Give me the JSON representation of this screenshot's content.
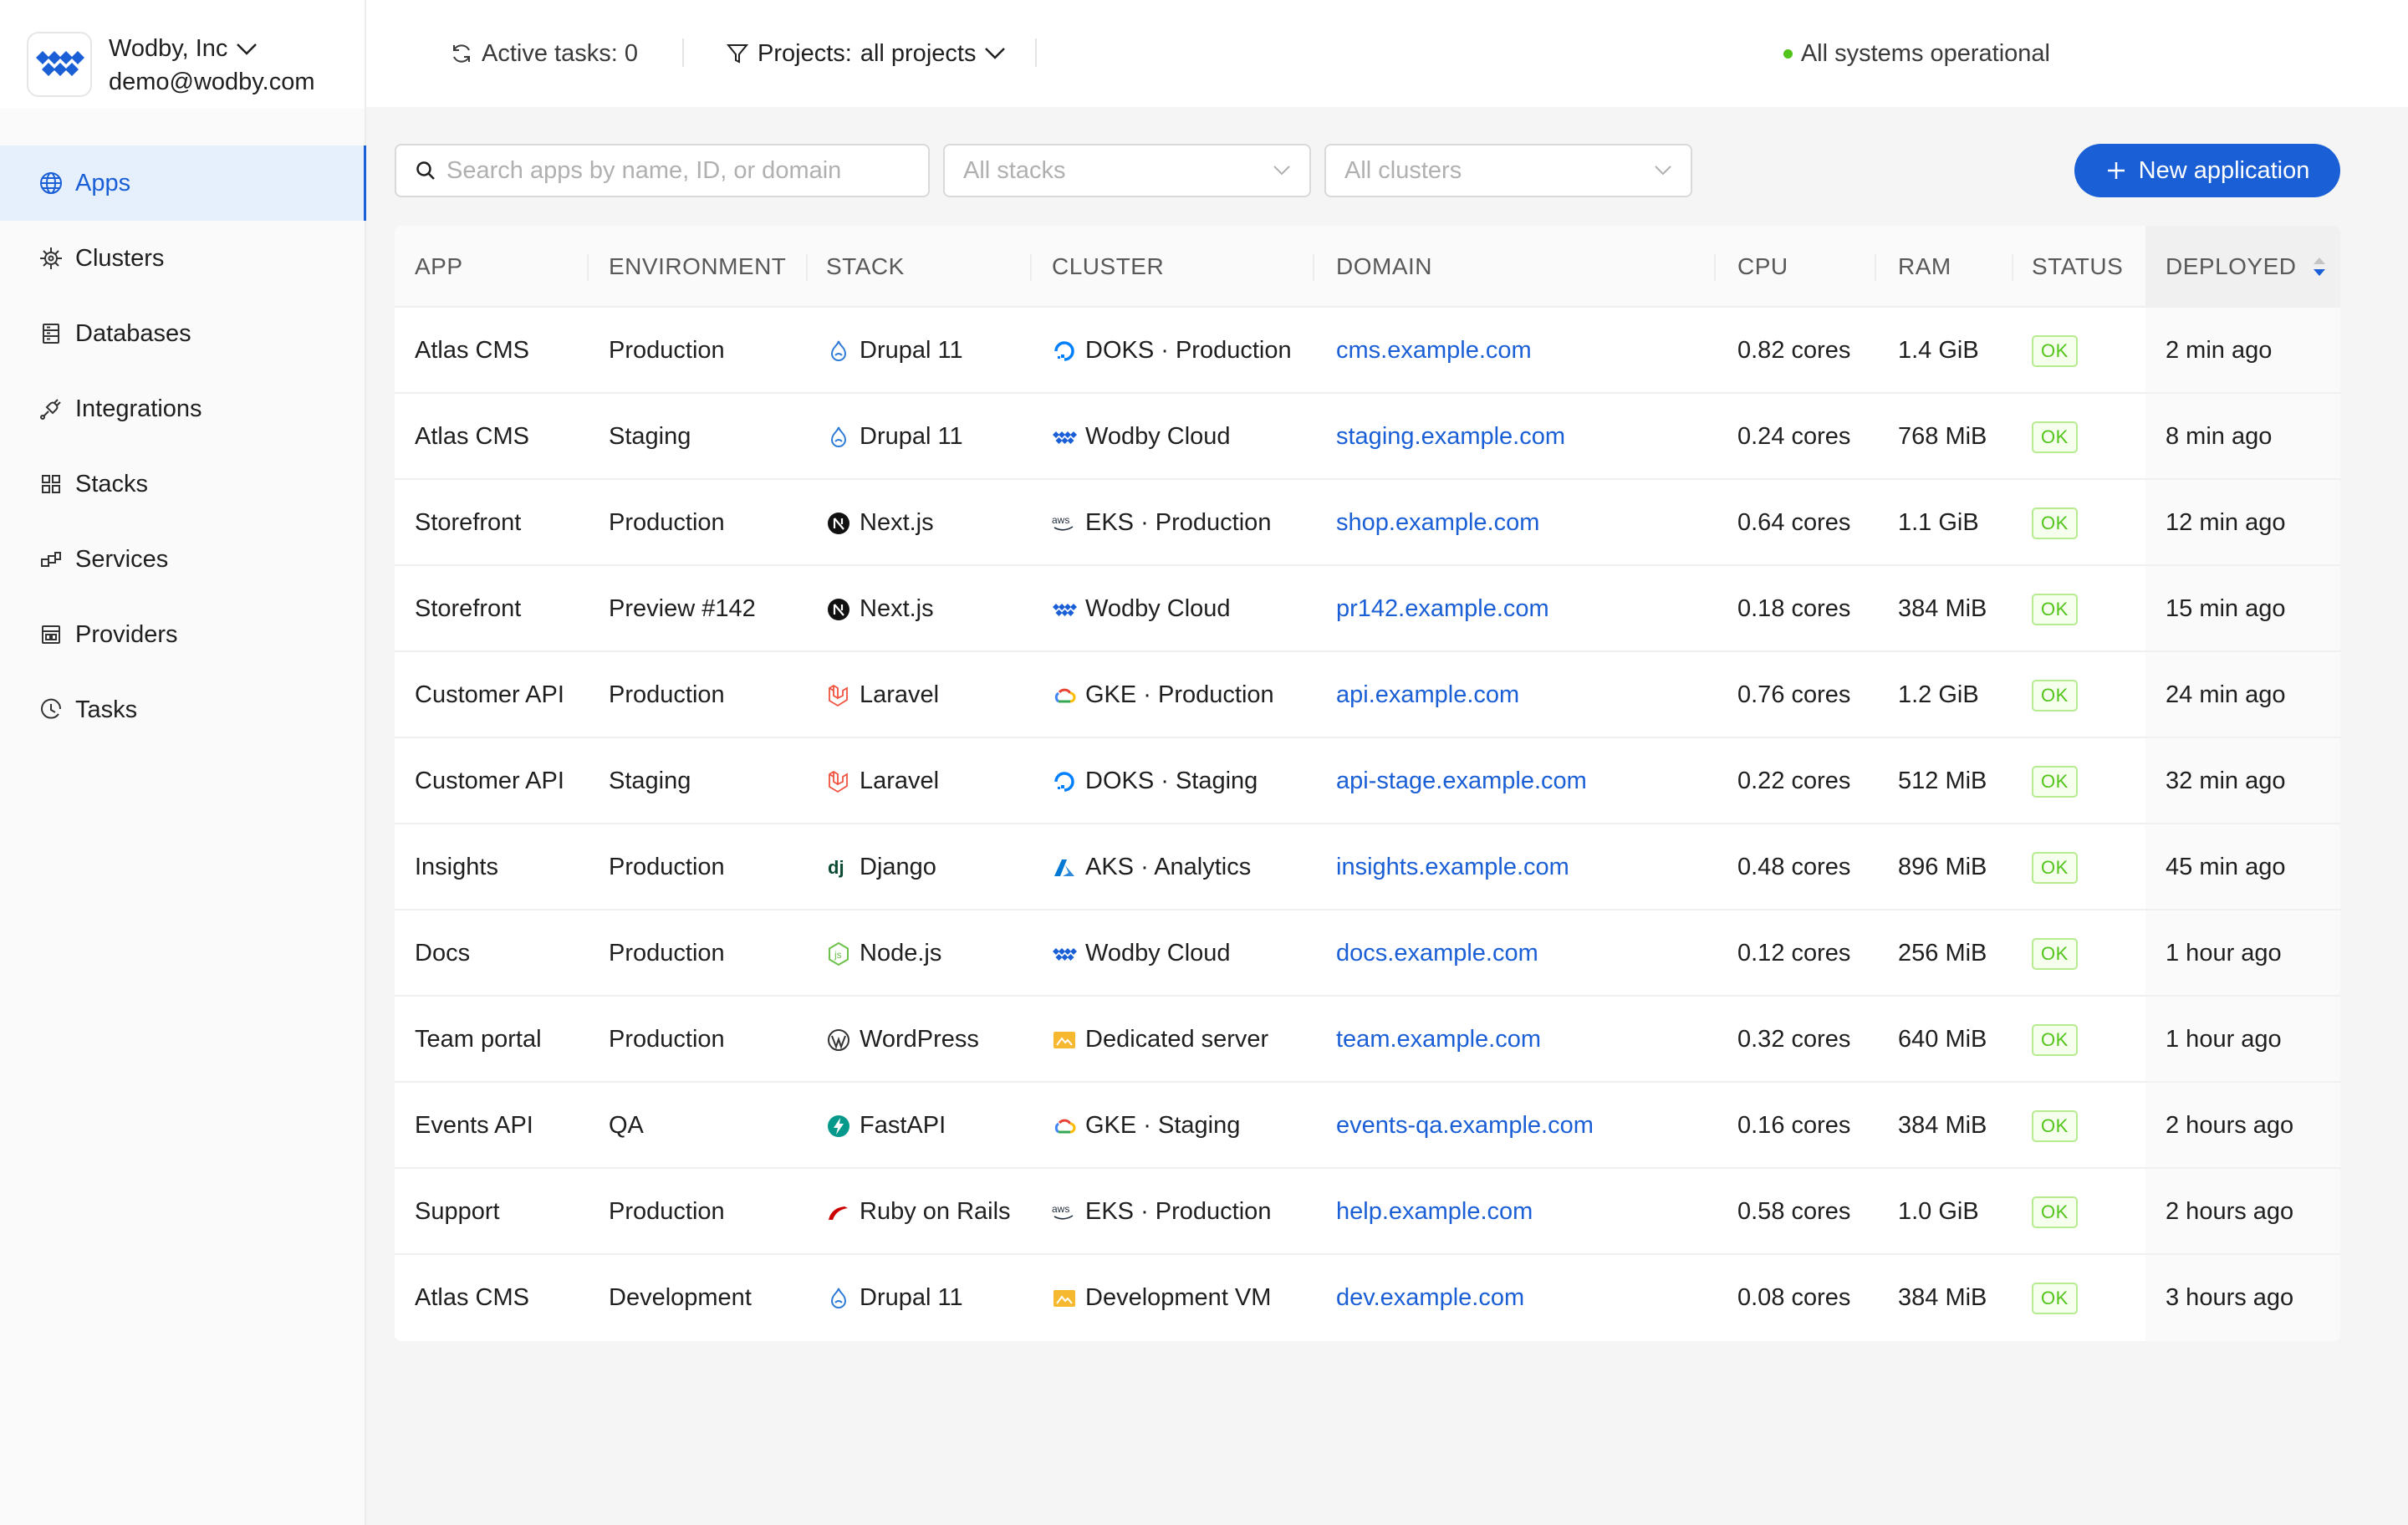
{
  "org": {
    "name": "Wodby, Inc",
    "email": "demo@wodby.com"
  },
  "nav": [
    {
      "label": "Apps",
      "icon": "globe-icon",
      "active": true
    },
    {
      "label": "Clusters",
      "icon": "helm-icon",
      "active": false
    },
    {
      "label": "Databases",
      "icon": "database-icon",
      "active": false
    },
    {
      "label": "Integrations",
      "icon": "plug-icon",
      "active": false
    },
    {
      "label": "Stacks",
      "icon": "grid-icon",
      "active": false
    },
    {
      "label": "Services",
      "icon": "blocks-icon",
      "active": false
    },
    {
      "label": "Providers",
      "icon": "server-icon",
      "active": false
    },
    {
      "label": "Tasks",
      "icon": "history-icon",
      "active": false
    }
  ],
  "topbar": {
    "active_tasks": "Active tasks: 0",
    "projects_label": "Projects:",
    "projects_value": "all projects",
    "system_status": "All systems operational"
  },
  "toolbar": {
    "search_placeholder": "Search apps by name, ID, or domain",
    "stacks_placeholder": "All stacks",
    "clusters_placeholder": "All clusters",
    "new_app_label": "New application"
  },
  "table": {
    "headers": {
      "app": "APP",
      "environment": "ENVIRONMENT",
      "stack": "STACK",
      "cluster": "CLUSTER",
      "domain": "DOMAIN",
      "cpu": "CPU",
      "ram": "RAM",
      "status": "STATUS",
      "deployed": "DEPLOYED"
    },
    "rows": [
      {
        "app": "Atlas CMS",
        "environment": "Production",
        "stack": "Drupal 11",
        "stack_icon": "drupal-icon",
        "cluster": "DOKS · Production",
        "cluster_icon": "digitalocean-icon",
        "domain": "cms.example.com",
        "cpu": "0.82 cores",
        "ram": "1.4 GiB",
        "status": "OK",
        "deployed": "2 min ago"
      },
      {
        "app": "Atlas CMS",
        "environment": "Staging",
        "stack": "Drupal 11",
        "stack_icon": "drupal-icon",
        "cluster": "Wodby Cloud",
        "cluster_icon": "wodby-icon",
        "domain": "staging.example.com",
        "cpu": "0.24 cores",
        "ram": "768 MiB",
        "status": "OK",
        "deployed": "8 min ago"
      },
      {
        "app": "Storefront",
        "environment": "Production",
        "stack": "Next.js",
        "stack_icon": "nextjs-icon",
        "cluster": "EKS · Production",
        "cluster_icon": "aws-icon",
        "domain": "shop.example.com",
        "cpu": "0.64 cores",
        "ram": "1.1 GiB",
        "status": "OK",
        "deployed": "12 min ago"
      },
      {
        "app": "Storefront",
        "environment": "Preview #142",
        "stack": "Next.js",
        "stack_icon": "nextjs-icon",
        "cluster": "Wodby Cloud",
        "cluster_icon": "wodby-icon",
        "domain": "pr142.example.com",
        "cpu": "0.18 cores",
        "ram": "384 MiB",
        "status": "OK",
        "deployed": "15 min ago"
      },
      {
        "app": "Customer API",
        "environment": "Production",
        "stack": "Laravel",
        "stack_icon": "laravel-icon",
        "cluster": "GKE · Production",
        "cluster_icon": "gcloud-icon",
        "domain": "api.example.com",
        "cpu": "0.76 cores",
        "ram": "1.2 GiB",
        "status": "OK",
        "deployed": "24 min ago"
      },
      {
        "app": "Customer API",
        "environment": "Staging",
        "stack": "Laravel",
        "stack_icon": "laravel-icon",
        "cluster": "DOKS · Staging",
        "cluster_icon": "digitalocean-icon",
        "domain": "api-stage.example.com",
        "cpu": "0.22 cores",
        "ram": "512 MiB",
        "status": "OK",
        "deployed": "32 min ago"
      },
      {
        "app": "Insights",
        "environment": "Production",
        "stack": "Django",
        "stack_icon": "django-icon",
        "cluster": "AKS · Analytics",
        "cluster_icon": "azure-icon",
        "domain": "insights.example.com",
        "cpu": "0.48 cores",
        "ram": "896 MiB",
        "status": "OK",
        "deployed": "45 min ago"
      },
      {
        "app": "Docs",
        "environment": "Production",
        "stack": "Node.js",
        "stack_icon": "nodejs-icon",
        "cluster": "Wodby Cloud",
        "cluster_icon": "wodby-icon",
        "domain": "docs.example.com",
        "cpu": "0.12 cores",
        "ram": "256 MiB",
        "status": "OK",
        "deployed": "1 hour ago"
      },
      {
        "app": "Team portal",
        "environment": "Production",
        "stack": "WordPress",
        "stack_icon": "wordpress-icon",
        "cluster": "Dedicated server",
        "cluster_icon": "server-box-icon",
        "domain": "team.example.com",
        "cpu": "0.32 cores",
        "ram": "640 MiB",
        "status": "OK",
        "deployed": "1 hour ago"
      },
      {
        "app": "Events API",
        "environment": "QA",
        "stack": "FastAPI",
        "stack_icon": "fastapi-icon",
        "cluster": "GKE · Staging",
        "cluster_icon": "gcloud-icon",
        "domain": "events-qa.example.com",
        "cpu": "0.16 cores",
        "ram": "384 MiB",
        "status": "OK",
        "deployed": "2 hours ago"
      },
      {
        "app": "Support",
        "environment": "Production",
        "stack": "Ruby on Rails",
        "stack_icon": "rails-icon",
        "cluster": "EKS · Production",
        "cluster_icon": "aws-icon",
        "domain": "help.example.com",
        "cpu": "0.58 cores",
        "ram": "1.0 GiB",
        "status": "OK",
        "deployed": "2 hours ago"
      },
      {
        "app": "Atlas CMS",
        "environment": "Development",
        "stack": "Drupal 11",
        "stack_icon": "drupal-icon",
        "cluster": "Development VM",
        "cluster_icon": "server-box-icon",
        "domain": "dev.example.com",
        "cpu": "0.08 cores",
        "ram": "384 MiB",
        "status": "OK",
        "deployed": "3 hours ago"
      }
    ]
  },
  "colors": {
    "accent": "#1a5fd6",
    "ok": "#52c41a"
  }
}
